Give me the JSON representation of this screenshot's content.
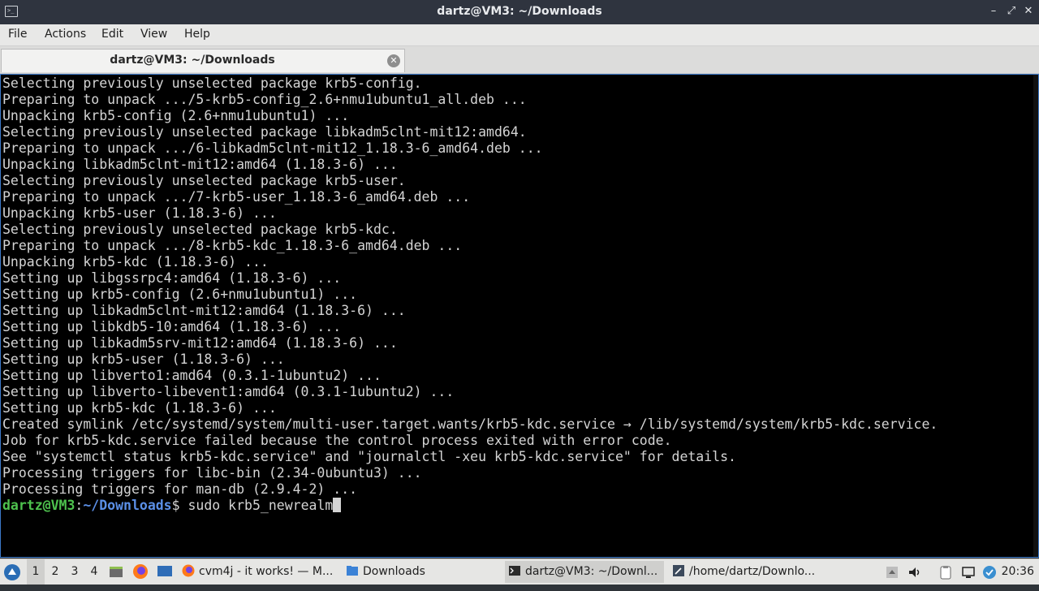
{
  "window": {
    "title": "dartz@VM3: ~/Downloads",
    "controls": {
      "minimize": "–",
      "maximize": "⤢",
      "close": "✕"
    }
  },
  "menu": [
    "File",
    "Actions",
    "Edit",
    "View",
    "Help"
  ],
  "tabs": [
    {
      "label": "dartz@VM3: ~/Downloads",
      "close": "✕"
    }
  ],
  "terminal": {
    "lines": [
      "Selecting previously unselected package krb5-config.",
      "Preparing to unpack .../5-krb5-config_2.6+nmu1ubuntu1_all.deb ...",
      "Unpacking krb5-config (2.6+nmu1ubuntu1) ...",
      "Selecting previously unselected package libkadm5clnt-mit12:amd64.",
      "Preparing to unpack .../6-libkadm5clnt-mit12_1.18.3-6_amd64.deb ...",
      "Unpacking libkadm5clnt-mit12:amd64 (1.18.3-6) ...",
      "Selecting previously unselected package krb5-user.",
      "Preparing to unpack .../7-krb5-user_1.18.3-6_amd64.deb ...",
      "Unpacking krb5-user (1.18.3-6) ...",
      "Selecting previously unselected package krb5-kdc.",
      "Preparing to unpack .../8-krb5-kdc_1.18.3-6_amd64.deb ...",
      "Unpacking krb5-kdc (1.18.3-6) ...",
      "Setting up libgssrpc4:amd64 (1.18.3-6) ...",
      "Setting up krb5-config (2.6+nmu1ubuntu1) ...",
      "Setting up libkadm5clnt-mit12:amd64 (1.18.3-6) ...",
      "Setting up libkdb5-10:amd64 (1.18.3-6) ...",
      "Setting up libkadm5srv-mit12:amd64 (1.18.3-6) ...",
      "Setting up krb5-user (1.18.3-6) ...",
      "Setting up libverto1:amd64 (0.3.1-1ubuntu2) ...",
      "Setting up libverto-libevent1:amd64 (0.3.1-1ubuntu2) ...",
      "Setting up krb5-kdc (1.18.3-6) ...",
      "Created symlink /etc/systemd/system/multi-user.target.wants/krb5-kdc.service → /lib/systemd/system/krb5-kdc.service.",
      "Job for krb5-kdc.service failed because the control process exited with error code.",
      "See \"systemctl status krb5-kdc.service\" and \"journalctl -xeu krb5-kdc.service\" for details.",
      "Processing triggers for libc-bin (2.34-0ubuntu3) ...",
      "Processing triggers for man-db (2.9.4-2) ..."
    ],
    "prompt": {
      "user_host": "dartz@VM3",
      "separator": ":",
      "path": "~/Downloads",
      "symbol": "$",
      "command": "sudo krb5_newrealm"
    }
  },
  "taskbar": {
    "workspaces": [
      "1",
      "2",
      "3",
      "4"
    ],
    "active_workspace": "1",
    "tasks": [
      {
        "label": "cvm4j - it works! — M...",
        "icon": "firefox-icon"
      },
      {
        "label": "Downloads",
        "icon": "folder-icon"
      },
      {
        "label": "dartz@VM3: ~/Downl...",
        "icon": "terminal-icon",
        "active": true
      },
      {
        "label": "/home/dartz/Downlo...",
        "icon": "text-editor-icon"
      }
    ],
    "clock": "20:36"
  },
  "colors": {
    "titlebar": "#2f343f",
    "terminal_bg": "#000000",
    "prompt_user": "#4ec24e",
    "prompt_path": "#5b8fe6"
  }
}
